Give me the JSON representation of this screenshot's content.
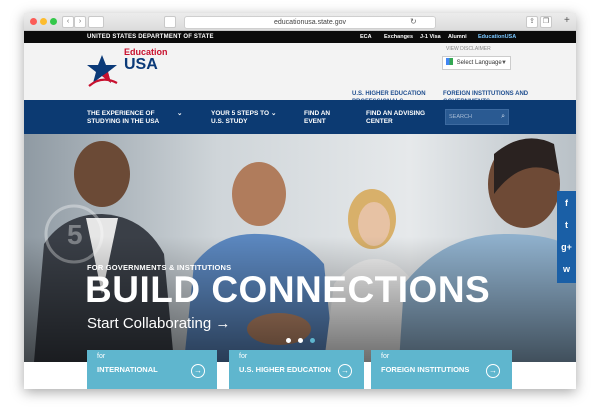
{
  "browser": {
    "url": "educationusa.state.gov",
    "back": "‹",
    "forward": "›"
  },
  "topbar": {
    "department": "UNITED STATES DEPARTMENT OF STATE",
    "links": [
      "ECA",
      "Exchanges",
      "J-1 Visa",
      "Alumni",
      "EducationUSA"
    ]
  },
  "logo": {
    "line1": "Education",
    "line2": "USA",
    "star_badge": "5"
  },
  "header": {
    "view_disclaimer": "VIEW DISCLAIMER",
    "language_label": "Select Language",
    "link_professionals": "U.S. HIGHER EDUCATION PROFESSIONALS",
    "link_foreign": "FOREIGN INSTITUTIONS AND GOVERNMENTS"
  },
  "nav": {
    "items": [
      "THE EXPERIENCE OF STUDYING IN THE USA",
      "YOUR 5 STEPS TO U.S. STUDY",
      "FIND AN EVENT",
      "FIND AN ADVISING CENTER"
    ],
    "search_placeholder": "SEARCH"
  },
  "hero": {
    "kicker": "FOR GOVERNMENTS & INSTITUTIONS",
    "headline": "BUILD CONNECTIONS",
    "cta": "Start Collaborating →",
    "slide_count": 3,
    "active_slide": 3
  },
  "social": [
    "f",
    "t",
    "g+",
    "w"
  ],
  "tiles": [
    {
      "for": "for",
      "title": "INTERNATIONAL"
    },
    {
      "for": "for",
      "title": "U.S. HIGHER EDUCATION"
    },
    {
      "for": "for",
      "title": "FOREIGN INSTITUTIONS"
    }
  ],
  "colors": {
    "navy": "#0c3a72",
    "red": "#c8102e",
    "tile": "#5fb6ce"
  }
}
